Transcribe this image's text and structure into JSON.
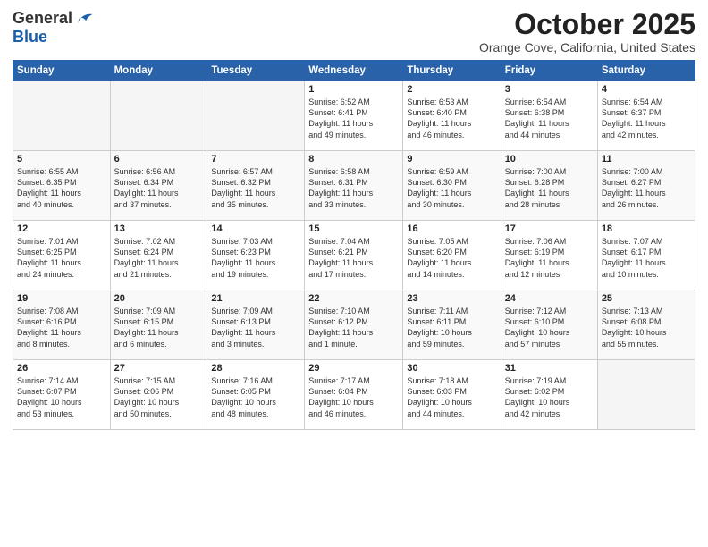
{
  "logo": {
    "general": "General",
    "blue": "Blue"
  },
  "header": {
    "month": "October 2025",
    "location": "Orange Cove, California, United States"
  },
  "days_of_week": [
    "Sunday",
    "Monday",
    "Tuesday",
    "Wednesday",
    "Thursday",
    "Friday",
    "Saturday"
  ],
  "weeks": [
    [
      {
        "day": "",
        "info": ""
      },
      {
        "day": "",
        "info": ""
      },
      {
        "day": "",
        "info": ""
      },
      {
        "day": "1",
        "info": "Sunrise: 6:52 AM\nSunset: 6:41 PM\nDaylight: 11 hours\nand 49 minutes."
      },
      {
        "day": "2",
        "info": "Sunrise: 6:53 AM\nSunset: 6:40 PM\nDaylight: 11 hours\nand 46 minutes."
      },
      {
        "day": "3",
        "info": "Sunrise: 6:54 AM\nSunset: 6:38 PM\nDaylight: 11 hours\nand 44 minutes."
      },
      {
        "day": "4",
        "info": "Sunrise: 6:54 AM\nSunset: 6:37 PM\nDaylight: 11 hours\nand 42 minutes."
      }
    ],
    [
      {
        "day": "5",
        "info": "Sunrise: 6:55 AM\nSunset: 6:35 PM\nDaylight: 11 hours\nand 40 minutes."
      },
      {
        "day": "6",
        "info": "Sunrise: 6:56 AM\nSunset: 6:34 PM\nDaylight: 11 hours\nand 37 minutes."
      },
      {
        "day": "7",
        "info": "Sunrise: 6:57 AM\nSunset: 6:32 PM\nDaylight: 11 hours\nand 35 minutes."
      },
      {
        "day": "8",
        "info": "Sunrise: 6:58 AM\nSunset: 6:31 PM\nDaylight: 11 hours\nand 33 minutes."
      },
      {
        "day": "9",
        "info": "Sunrise: 6:59 AM\nSunset: 6:30 PM\nDaylight: 11 hours\nand 30 minutes."
      },
      {
        "day": "10",
        "info": "Sunrise: 7:00 AM\nSunset: 6:28 PM\nDaylight: 11 hours\nand 28 minutes."
      },
      {
        "day": "11",
        "info": "Sunrise: 7:00 AM\nSunset: 6:27 PM\nDaylight: 11 hours\nand 26 minutes."
      }
    ],
    [
      {
        "day": "12",
        "info": "Sunrise: 7:01 AM\nSunset: 6:25 PM\nDaylight: 11 hours\nand 24 minutes."
      },
      {
        "day": "13",
        "info": "Sunrise: 7:02 AM\nSunset: 6:24 PM\nDaylight: 11 hours\nand 21 minutes."
      },
      {
        "day": "14",
        "info": "Sunrise: 7:03 AM\nSunset: 6:23 PM\nDaylight: 11 hours\nand 19 minutes."
      },
      {
        "day": "15",
        "info": "Sunrise: 7:04 AM\nSunset: 6:21 PM\nDaylight: 11 hours\nand 17 minutes."
      },
      {
        "day": "16",
        "info": "Sunrise: 7:05 AM\nSunset: 6:20 PM\nDaylight: 11 hours\nand 14 minutes."
      },
      {
        "day": "17",
        "info": "Sunrise: 7:06 AM\nSunset: 6:19 PM\nDaylight: 11 hours\nand 12 minutes."
      },
      {
        "day": "18",
        "info": "Sunrise: 7:07 AM\nSunset: 6:17 PM\nDaylight: 11 hours\nand 10 minutes."
      }
    ],
    [
      {
        "day": "19",
        "info": "Sunrise: 7:08 AM\nSunset: 6:16 PM\nDaylight: 11 hours\nand 8 minutes."
      },
      {
        "day": "20",
        "info": "Sunrise: 7:09 AM\nSunset: 6:15 PM\nDaylight: 11 hours\nand 6 minutes."
      },
      {
        "day": "21",
        "info": "Sunrise: 7:09 AM\nSunset: 6:13 PM\nDaylight: 11 hours\nand 3 minutes."
      },
      {
        "day": "22",
        "info": "Sunrise: 7:10 AM\nSunset: 6:12 PM\nDaylight: 11 hours\nand 1 minute."
      },
      {
        "day": "23",
        "info": "Sunrise: 7:11 AM\nSunset: 6:11 PM\nDaylight: 10 hours\nand 59 minutes."
      },
      {
        "day": "24",
        "info": "Sunrise: 7:12 AM\nSunset: 6:10 PM\nDaylight: 10 hours\nand 57 minutes."
      },
      {
        "day": "25",
        "info": "Sunrise: 7:13 AM\nSunset: 6:08 PM\nDaylight: 10 hours\nand 55 minutes."
      }
    ],
    [
      {
        "day": "26",
        "info": "Sunrise: 7:14 AM\nSunset: 6:07 PM\nDaylight: 10 hours\nand 53 minutes."
      },
      {
        "day": "27",
        "info": "Sunrise: 7:15 AM\nSunset: 6:06 PM\nDaylight: 10 hours\nand 50 minutes."
      },
      {
        "day": "28",
        "info": "Sunrise: 7:16 AM\nSunset: 6:05 PM\nDaylight: 10 hours\nand 48 minutes."
      },
      {
        "day": "29",
        "info": "Sunrise: 7:17 AM\nSunset: 6:04 PM\nDaylight: 10 hours\nand 46 minutes."
      },
      {
        "day": "30",
        "info": "Sunrise: 7:18 AM\nSunset: 6:03 PM\nDaylight: 10 hours\nand 44 minutes."
      },
      {
        "day": "31",
        "info": "Sunrise: 7:19 AM\nSunset: 6:02 PM\nDaylight: 10 hours\nand 42 minutes."
      },
      {
        "day": "",
        "info": ""
      }
    ]
  ]
}
